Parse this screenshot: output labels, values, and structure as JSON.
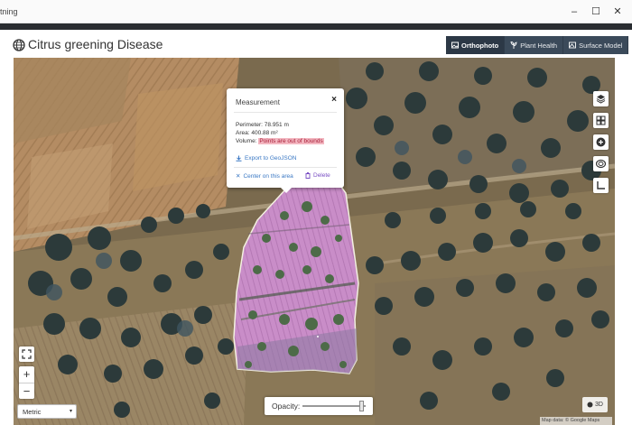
{
  "window": {
    "title_fragment": "tning",
    "controls": {
      "minimize": "–",
      "maximize": "☐",
      "close": "✕"
    }
  },
  "header": {
    "title": "Citrus greening Disease",
    "globe_icon": "globe-icon",
    "tabs": [
      {
        "label": "Orthophoto",
        "icon": "image-icon",
        "active": true
      },
      {
        "label": "Plant Health",
        "icon": "plant-icon",
        "active": false
      },
      {
        "label": "Surface Model",
        "icon": "mountain-icon",
        "active": false
      }
    ]
  },
  "popup": {
    "title": "Measurement",
    "close": "×",
    "perimeter": "Perimeter: 78.951 m",
    "area": "Area: 400.88 m²",
    "volume_label": "Volume:",
    "volume_error": "Points are out of bounds",
    "export_label": "Export to GeoJSON",
    "center_label": "Center on this area",
    "delete_label": "Delete"
  },
  "map_controls": {
    "right": [
      "layers-icon",
      "grid-icon",
      "add-icon",
      "measure-icon",
      "crop-icon"
    ],
    "zoom_in": "+",
    "zoom_out": "−",
    "units_value": "Metric",
    "units_arrow": "▾",
    "opacity_label": "Opacity:",
    "opacity_value": 0.95,
    "btn_3d": "3D",
    "attribution": "Map data: © Google Maps"
  },
  "colors": {
    "tab_active": "#2c3846",
    "tab": "#3b4a5a",
    "polygon_fill": "#d88fd8",
    "polygon_stroke": "#f3f0e0",
    "error_bg": "#f3b6c0"
  }
}
